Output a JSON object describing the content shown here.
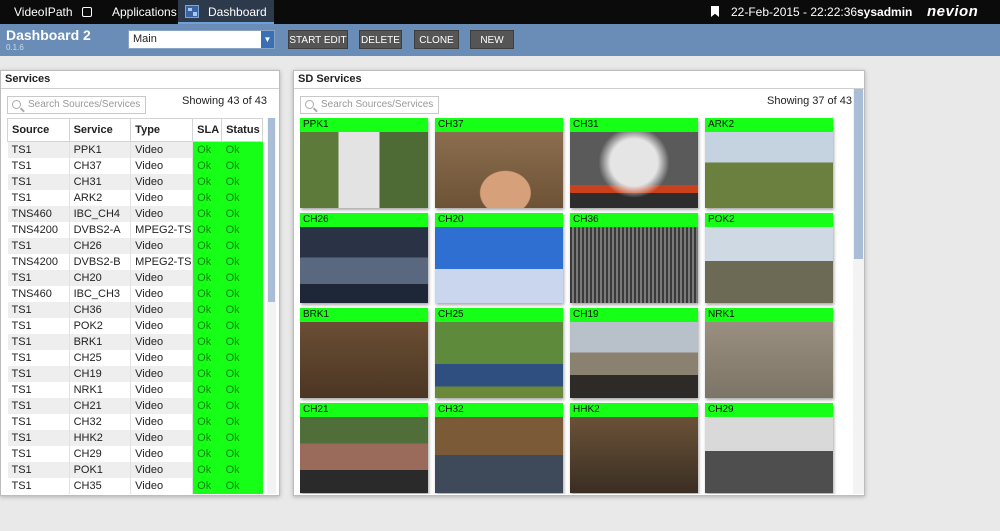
{
  "topbar": {
    "tab_videopath": "VideoIPath",
    "tab_applications": "Applications",
    "tab_dashboard": "Dashboard 2",
    "datetime": "22-Feb-2015 - 22:22:36",
    "user": "sysadmin",
    "logo": "nevion"
  },
  "header": {
    "title": "Dashboard 2",
    "version": "0.1.6",
    "select_value": "Main",
    "btn_start_edit": "START EDIT",
    "btn_delete": "DELETE",
    "btn_clone": "CLONE",
    "btn_new": "NEW"
  },
  "services": {
    "title": "Services",
    "search_placeholder": "Search Sources/Services",
    "showing": "Showing 43 of 43",
    "columns": [
      "Source",
      "Service",
      "Type",
      "SLA",
      "Status"
    ],
    "rows": [
      [
        "TS1",
        "PPK1",
        "Video",
        "Ok",
        "Ok"
      ],
      [
        "TS1",
        "CH37",
        "Video",
        "Ok",
        "Ok"
      ],
      [
        "TS1",
        "CH31",
        "Video",
        "Ok",
        "Ok"
      ],
      [
        "TS1",
        "ARK2",
        "Video",
        "Ok",
        "Ok"
      ],
      [
        "TNS460",
        "IBC_CH4",
        "Video",
        "Ok",
        "Ok"
      ],
      [
        "TNS4200",
        "DVBS2-A",
        "MPEG2-TS",
        "Ok",
        "Ok"
      ],
      [
        "TS1",
        "CH26",
        "Video",
        "Ok",
        "Ok"
      ],
      [
        "TNS4200",
        "DVBS2-B",
        "MPEG2-TS",
        "Ok",
        "Ok"
      ],
      [
        "TS1",
        "CH20",
        "Video",
        "Ok",
        "Ok"
      ],
      [
        "TNS460",
        "IBC_CH3",
        "Video",
        "Ok",
        "Ok"
      ],
      [
        "TS1",
        "CH36",
        "Video",
        "Ok",
        "Ok"
      ],
      [
        "TS1",
        "POK2",
        "Video",
        "Ok",
        "Ok"
      ],
      [
        "TS1",
        "BRK1",
        "Video",
        "Ok",
        "Ok"
      ],
      [
        "TS1",
        "CH25",
        "Video",
        "Ok",
        "Ok"
      ],
      [
        "TS1",
        "CH19",
        "Video",
        "Ok",
        "Ok"
      ],
      [
        "TS1",
        "NRK1",
        "Video",
        "Ok",
        "Ok"
      ],
      [
        "TS1",
        "CH21",
        "Video",
        "Ok",
        "Ok"
      ],
      [
        "TS1",
        "CH32",
        "Video",
        "Ok",
        "Ok"
      ],
      [
        "TS1",
        "HHK2",
        "Video",
        "Ok",
        "Ok"
      ],
      [
        "TS1",
        "CH29",
        "Video",
        "Ok",
        "Ok"
      ],
      [
        "TS1",
        "POK1",
        "Video",
        "Ok",
        "Ok"
      ],
      [
        "TS1",
        "CH35",
        "Video",
        "Ok",
        "Ok"
      ]
    ]
  },
  "sd_services": {
    "title": "SD Services",
    "search_placeholder": "Search Sources/Services",
    "showing": "Showing 37 of 43",
    "tiles": [
      {
        "label": "PPK1",
        "thumb": "crowd-shirt"
      },
      {
        "label": "CH37",
        "thumb": "hand-closeup"
      },
      {
        "label": "CH31",
        "thumb": "volcano-smoke"
      },
      {
        "label": "ARK2",
        "thumb": "tower-field"
      },
      {
        "label": "CH26",
        "thumb": "parliament"
      },
      {
        "label": "CH20",
        "thumb": "news-studio"
      },
      {
        "label": "CH36",
        "thumb": "machinery"
      },
      {
        "label": "POK2",
        "thumb": "street-market"
      },
      {
        "label": "BRK1",
        "thumb": "ruins"
      },
      {
        "label": "CH25",
        "thumb": "interview-park"
      },
      {
        "label": "CH19",
        "thumb": "reporter-reichstag"
      },
      {
        "label": "NRK1",
        "thumb": "rocky-ground"
      },
      {
        "label": "CH21",
        "thumb": "festival-crowd"
      },
      {
        "label": "CH32",
        "thumb": "construction-worker"
      },
      {
        "label": "HHK2",
        "thumb": "workshop"
      },
      {
        "label": "CH29",
        "thumb": "bw-landscape"
      }
    ]
  },
  "colors": {
    "ok_green": "#16ff16",
    "header_blue": "#6a8db8",
    "topbar": "#0b0b0b"
  }
}
